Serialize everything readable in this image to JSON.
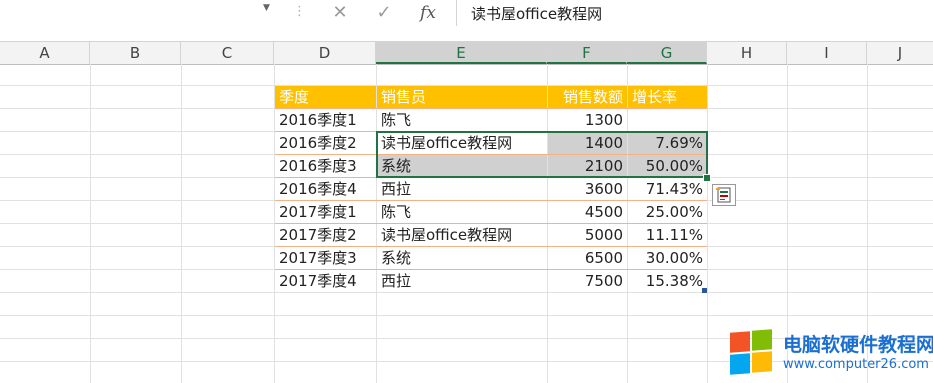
{
  "formula_bar": {
    "name_box": "",
    "cancel_symbol": "✕",
    "enter_symbol": "✓",
    "fx_label": "fx",
    "value": "读书屋office教程网"
  },
  "columns": [
    "A",
    "B",
    "C",
    "D",
    "E",
    "F",
    "G",
    "H",
    "I",
    "J"
  ],
  "table": {
    "headers": [
      "季度",
      "销售员",
      "销售数额",
      "增长率"
    ],
    "rows": [
      [
        "2016季度1",
        "陈飞",
        "1300",
        ""
      ],
      [
        "2016季度2",
        "读书屋office教程网",
        "1400",
        "7.69%"
      ],
      [
        "2016季度3",
        "系统",
        "2100",
        "50.00%"
      ],
      [
        "2016季度4",
        "西拉",
        "3600",
        "71.43%"
      ],
      [
        "2017季度1",
        "陈飞",
        "4500",
        "25.00%"
      ],
      [
        "2017季度2",
        "读书屋office教程网",
        "5000",
        "11.11%"
      ],
      [
        "2017季度3",
        "系统",
        "6500",
        "30.00%"
      ],
      [
        "2017季度4",
        "西拉",
        "7500",
        "15.38%"
      ]
    ]
  },
  "watermark": {
    "title": "电脑软硬件教程网",
    "url": "www.computer26.com"
  },
  "colors": {
    "header_fill": "#ffc000",
    "selection": "#217346",
    "selected_fill": "#d0d0d0",
    "row_border": "#f4b183"
  }
}
